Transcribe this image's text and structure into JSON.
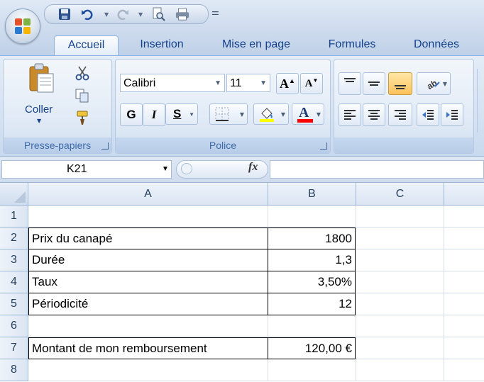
{
  "qat": {
    "save": "save-icon",
    "undo": "undo-icon",
    "redo": "redo-icon",
    "print_preview": "print-preview-icon",
    "print": "print-icon"
  },
  "tabs": [
    {
      "label": "Accueil",
      "active": true
    },
    {
      "label": "Insertion"
    },
    {
      "label": "Mise en page"
    },
    {
      "label": "Formules"
    },
    {
      "label": "Données"
    }
  ],
  "ribbon": {
    "clipboard": {
      "paste_label": "Coller",
      "group_label": "Presse-papiers"
    },
    "font": {
      "font_name": "Calibri",
      "font_size": "11",
      "bold": "G",
      "italic": "I",
      "underline": "S",
      "group_label": "Police",
      "highlight_color": "#ffff00",
      "font_color": "#ff0000"
    }
  },
  "formula_bar": {
    "name_box": "K21",
    "fx": "fx",
    "formula": ""
  },
  "grid": {
    "columns": [
      "A",
      "B",
      "C"
    ],
    "rows": [
      {
        "num": "1",
        "a": "",
        "b": ""
      },
      {
        "num": "2",
        "a": "Prix du canapé",
        "b": "1800"
      },
      {
        "num": "3",
        "a": "Durée",
        "b": "1,3"
      },
      {
        "num": "4",
        "a": "Taux",
        "b": "3,50%"
      },
      {
        "num": "5",
        "a": "Périodicité",
        "b": "12"
      },
      {
        "num": "6",
        "a": "",
        "b": ""
      },
      {
        "num": "7",
        "a": "Montant de mon remboursement",
        "b": "120,00 €"
      },
      {
        "num": "8",
        "a": "",
        "b": ""
      }
    ]
  }
}
